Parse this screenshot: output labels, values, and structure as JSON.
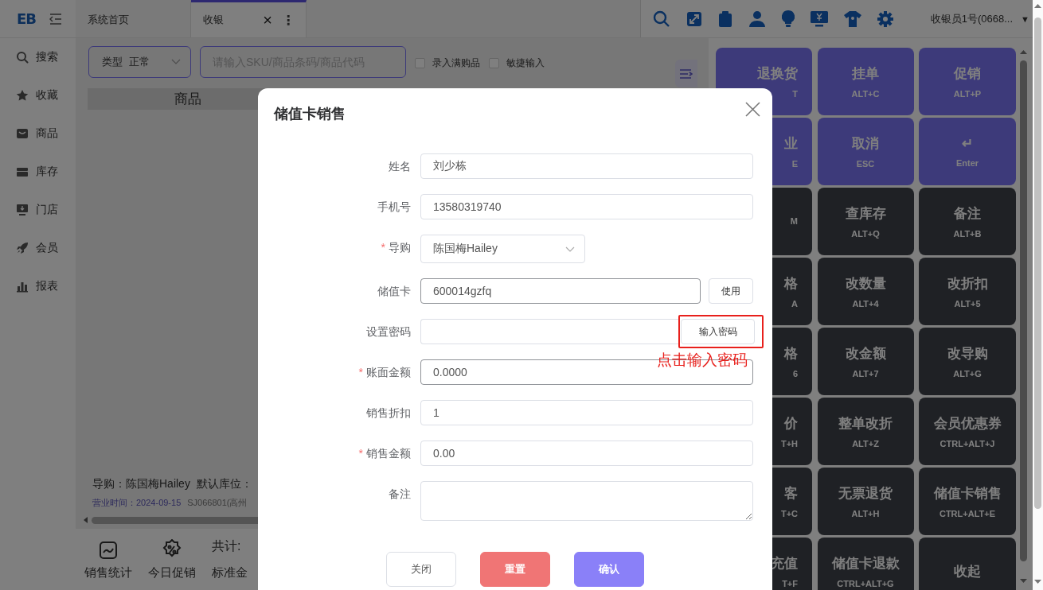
{
  "top_bar": {
    "logo": "EB",
    "tabs": [
      {
        "label": "系统首页",
        "selected": false
      },
      {
        "label": "收银",
        "selected": true,
        "close": "×",
        "menu": "⋮"
      }
    ],
    "user": "收银员1号(0668...",
    "user_caret": "▼"
  },
  "sidebar": {
    "items": [
      {
        "label": "搜索"
      },
      {
        "label": "收藏"
      },
      {
        "label": "商品"
      },
      {
        "label": "库存"
      },
      {
        "label": "门店"
      },
      {
        "label": "会员"
      },
      {
        "label": "报表"
      }
    ]
  },
  "main": {
    "type_select": {
      "label": "类型",
      "value": "正常"
    },
    "search": {
      "placeholder": "请输入SKU/商品条码/商品代码"
    },
    "options": [
      {
        "label": "录入满购品",
        "checked": false
      },
      {
        "label": "敏捷输入",
        "checked": false
      }
    ],
    "table": {
      "columns": [
        "商品"
      ]
    },
    "info": {
      "guide": "导购：陈国梅Hailey",
      "location": "默认库位：",
      "business_date": "营业时间：2024-09-15",
      "store": "SJ066801(高州"
    },
    "bottom_bar": {
      "actions": [
        {
          "label": "销售统计"
        },
        {
          "label": "今日促销"
        }
      ],
      "total_label": "共计:",
      "standard_amount": "标准金"
    }
  },
  "keypad": {
    "keys": [
      {
        "title": "退换货",
        "shortcut": "T",
        "kind": "primary"
      },
      {
        "title": "挂单",
        "shortcut": "ALT+C",
        "kind": "primary"
      },
      {
        "title": "促销",
        "shortcut": "ALT+P",
        "kind": "primary"
      },
      {
        "title": "业",
        "shortcut": "E",
        "kind": "primary"
      },
      {
        "title": "取消",
        "shortcut": "ESC",
        "kind": "primary"
      },
      {
        "title": "↵",
        "shortcut": "Enter",
        "kind": "primary"
      },
      {
        "shortcut": "M",
        "kind": "dark"
      },
      {
        "title": "查库存",
        "shortcut": "ALT+Q",
        "kind": "dark"
      },
      {
        "title": "备注",
        "shortcut": "ALT+B",
        "kind": "dark"
      },
      {
        "title": "格",
        "shortcut": "A",
        "kind": "dark"
      },
      {
        "title": "改数量",
        "shortcut": "ALT+4",
        "kind": "dark"
      },
      {
        "title": "改折扣",
        "shortcut": "ALT+5",
        "kind": "dark"
      },
      {
        "title": "格",
        "shortcut": "6",
        "kind": "dark"
      },
      {
        "title": "改金额",
        "shortcut": "ALT+7",
        "kind": "dark"
      },
      {
        "title": "改导购",
        "shortcut": "ALT+G",
        "kind": "dark"
      },
      {
        "title": "价",
        "shortcut": "T+H",
        "kind": "dark"
      },
      {
        "title": "整单改折",
        "shortcut": "ALT+Z",
        "kind": "dark"
      },
      {
        "title": "会员优惠券",
        "shortcut": "CTRL+ALT+J",
        "kind": "dark"
      },
      {
        "title": "客",
        "shortcut": "T+C",
        "kind": "dark"
      },
      {
        "title": "无票退货",
        "shortcut": "ALT+H",
        "kind": "dark"
      },
      {
        "title": "储值卡销售",
        "shortcut": "CTRL+ALT+E",
        "kind": "dark"
      },
      {
        "title": "充值",
        "shortcut": "T+F",
        "kind": "dark"
      },
      {
        "title": "储值卡退款",
        "shortcut": "CTRL+ALT+G",
        "kind": "dark"
      },
      {
        "title": "收起",
        "kind": "dark"
      }
    ]
  },
  "dialog": {
    "title": "储值卡销售",
    "required_mark": "*",
    "fields": [
      {
        "label": "姓名",
        "required": false,
        "kind": "input",
        "value": "刘少栋",
        "focused": false
      },
      {
        "label": "手机号",
        "required": false,
        "kind": "input",
        "value": "13580319740",
        "focused": false
      },
      {
        "label": "导购",
        "required": true,
        "kind": "select",
        "value": "陈国梅Hailey"
      },
      {
        "label": "储值卡",
        "required": false,
        "kind": "input_button",
        "value": "600014gzfq",
        "button": "使用",
        "focused": true
      },
      {
        "label": "设置密码",
        "required": false,
        "kind": "password",
        "button": "输入密码",
        "highlighted": true,
        "callout": "点击输入密码"
      },
      {
        "label": "账面金额",
        "required": true,
        "kind": "input",
        "value": "0.0000",
        "focused": true
      },
      {
        "label": "销售折扣",
        "required": false,
        "kind": "input",
        "value": "1",
        "focused": false
      },
      {
        "label": "销售金额",
        "required": true,
        "kind": "input",
        "value": "0.00",
        "focused": false
      },
      {
        "label": "备注",
        "required": false,
        "kind": "textarea"
      }
    ],
    "buttons": [
      {
        "label": "关闭",
        "kind": "default"
      },
      {
        "label": "重置",
        "kind": "danger"
      },
      {
        "label": "确认",
        "kind": "primary"
      }
    ]
  }
}
